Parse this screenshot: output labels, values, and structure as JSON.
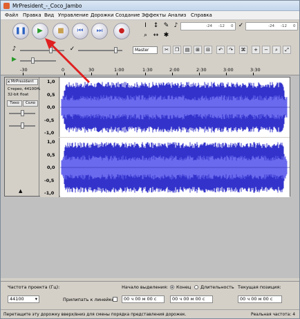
{
  "window": {
    "title": "MrPresident_-_Coco_Jambo"
  },
  "menu": [
    "Файл",
    "Правка",
    "Вид",
    "Управление",
    "Дорожки",
    "Создание",
    "Эффекты",
    "Анализ",
    "Справка"
  ],
  "toolbar": {
    "buttons": [
      {
        "name": "pause-button",
        "icon": "pause-icon",
        "glyph": "❚❚",
        "color": "#2a60c0"
      },
      {
        "name": "play-button",
        "icon": "play-icon",
        "glyph": "▶",
        "color": "#2a9a2a"
      },
      {
        "name": "stop-button",
        "icon": "stop-icon",
        "glyph": "■",
        "color": "#c8a050"
      },
      {
        "name": "skip-start-button",
        "icon": "skip-start-icon",
        "glyph": "⏮",
        "color": "#4a70c8"
      },
      {
        "name": "skip-end-button",
        "icon": "skip-end-icon",
        "glyph": "⏭",
        "color": "#4a70c8"
      },
      {
        "name": "record-button",
        "icon": "record-icon",
        "glyph": "●",
        "color": "#c82020"
      }
    ],
    "meter_labels": {
      "db_left": "-24",
      "db_mid": "-12",
      "db_right": "0",
      "db_left2": "-24",
      "db_mid2": "-12",
      "db_right2": "0"
    },
    "host": "Master"
  },
  "ruler": {
    "ticks": [
      "-30",
      "0",
      "30",
      "1:00",
      "1:30",
      "2:00",
      "2:30",
      "3:00",
      "3:30"
    ]
  },
  "track": {
    "name": "MrPresident",
    "info_line1": "Стерео, 44100Hz",
    "info_line2": "32-bit float",
    "mute": "Тихо",
    "solo": "Соло",
    "scale": [
      "1,0",
      "0,5",
      "0,0",
      "-0,5",
      "-1,0"
    ],
    "wave_color": "#3333cc"
  },
  "selection": {
    "rate_label": "Частота проекта (Гц):",
    "rate_value": "44100",
    "snap_label": "Прилипать к линейке",
    "start_label": "Начало выделения:",
    "end_label": "Конец",
    "length_label": "Длительность",
    "position_label": "Текущая позиция:",
    "start_value": "00 ч 00 м 00 с",
    "end_value": "00 ч 00 м 00 с",
    "position_value": "00 ч 00 м 00 с"
  },
  "status": {
    "hint": "Перетащите эту дорожку вверх/вниз для смены порядка представления дорожек.",
    "rate": "Реальная частота: 4"
  }
}
